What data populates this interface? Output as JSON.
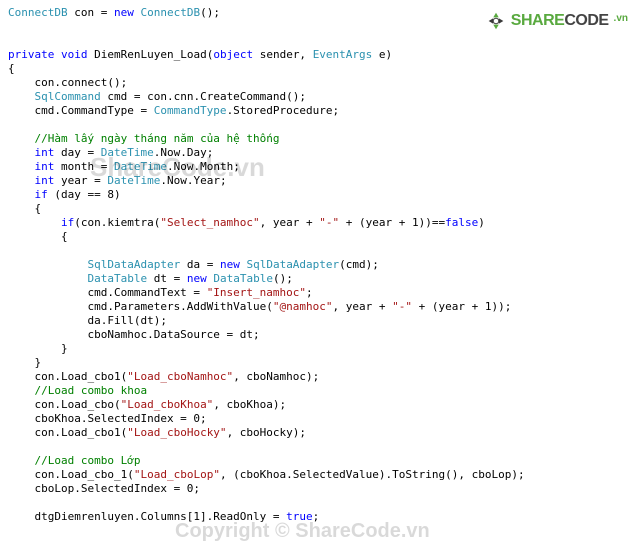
{
  "logo": {
    "share": "SHARE",
    "code": "CODE",
    "vn": ".vn"
  },
  "watermarks": {
    "w1": "ShareCode.vn",
    "w2": "Copyright © ShareCode.vn"
  },
  "code": {
    "l01a": "ConnectDB",
    "l01b": " con = ",
    "l01c": "new",
    "l01d": " ",
    "l01e": "ConnectDB",
    "l01f": "();",
    "l04a": "private",
    "l04b": " ",
    "l04c": "void",
    "l04d": " DiemRenLuyen_Load(",
    "l04e": "object",
    "l04f": " sender, ",
    "l04g": "EventArgs",
    "l04h": " e)",
    "l05": "{",
    "l06": "    con.connect();",
    "l07a": "    ",
    "l07b": "SqlCommand",
    "l07c": " cmd = con.cnn.CreateCommand();",
    "l08a": "    cmd.CommandType = ",
    "l08b": "CommandType",
    "l08c": ".StoredProcedure;",
    "l10a": "    ",
    "l10b": "//Hàm lấy ngày tháng năm của hệ thống",
    "l11a": "    ",
    "l11b": "int",
    "l11c": " day = ",
    "l11d": "DateTime",
    "l11e": ".Now.Day;",
    "l12a": "    ",
    "l12b": "int",
    "l12c": " month = ",
    "l12d": "DateTime",
    "l12e": ".Now.Month;",
    "l13a": "    ",
    "l13b": "int",
    "l13c": " year = ",
    "l13d": "DateTime",
    "l13e": ".Now.Year;",
    "l14a": "    ",
    "l14b": "if",
    "l14c": " (day == 8)",
    "l15": "    {",
    "l16a": "        ",
    "l16b": "if",
    "l16c": "(con.kiemtra(",
    "l16d": "\"Select_namhoc\"",
    "l16e": ", year + ",
    "l16f": "\"-\"",
    "l16g": " + (year + 1))==",
    "l16h": "false",
    "l16i": ")",
    "l17": "        {",
    "l19a": "            ",
    "l19b": "SqlDataAdapter",
    "l19c": " da = ",
    "l19d": "new",
    "l19e": " ",
    "l19f": "SqlDataAdapter",
    "l19g": "(cmd);",
    "l20a": "            ",
    "l20b": "DataTable",
    "l20c": " dt = ",
    "l20d": "new",
    "l20e": " ",
    "l20f": "DataTable",
    "l20g": "();",
    "l21a": "            cmd.CommandText = ",
    "l21b": "\"Insert_namhoc\"",
    "l21c": ";",
    "l22a": "            cmd.Parameters.AddWithValue(",
    "l22b": "\"@namhoc\"",
    "l22c": ", year + ",
    "l22d": "\"-\"",
    "l22e": " + (year + 1));",
    "l23": "            da.Fill(dt);",
    "l24": "            cboNamhoc.DataSource = dt;",
    "l25": "        }",
    "l26": "    }",
    "l27a": "    con.Load_cbo1(",
    "l27b": "\"Load_cboNamhoc\"",
    "l27c": ", cboNamhoc);",
    "l28a": "    ",
    "l28b": "//Load combo khoa",
    "l29a": "    con.Load_cbo(",
    "l29b": "\"Load_cboKhoa\"",
    "l29c": ", cboKhoa);",
    "l30": "    cboKhoa.SelectedIndex = 0;",
    "l31a": "    con.Load_cbo1(",
    "l31b": "\"Load_cboHocky\"",
    "l31c": ", cboHocky);",
    "l33a": "    ",
    "l33b": "//Load combo Lớp",
    "l34a": "    con.Load_cbo_1(",
    "l34b": "\"Load_cboLop\"",
    "l34c": ", (cboKhoa.SelectedValue).ToString(), cboLop);",
    "l35": "    cboLop.SelectedIndex = 0;",
    "l37a": "    dtgDiemrenluyen.Columns[1].ReadOnly = ",
    "l37b": "true",
    "l37c": ";"
  }
}
